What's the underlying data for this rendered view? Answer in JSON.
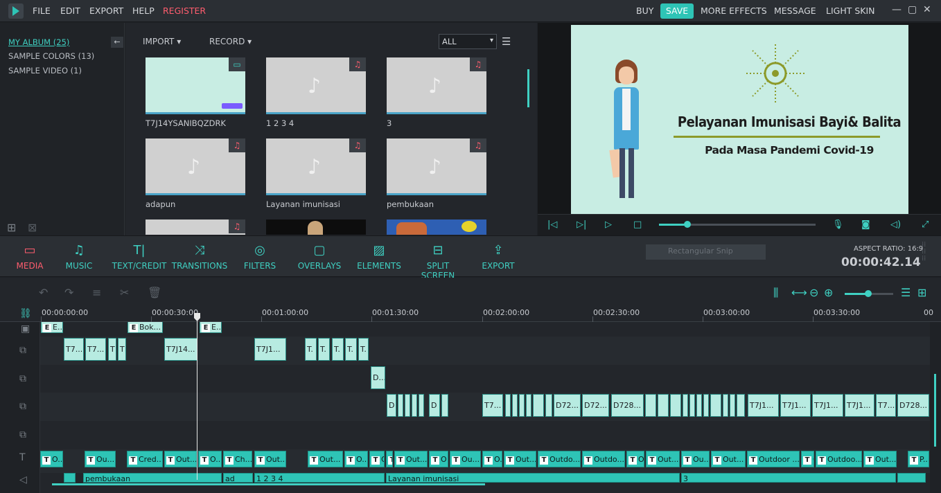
{
  "menu": {
    "file": "FILE",
    "edit": "EDIT",
    "export": "EXPORT",
    "help": "HELP",
    "register": "REGISTER",
    "buy": "BUY",
    "save": "SAVE",
    "more_effects": "MORE EFFECTS",
    "message": "MESSAGE",
    "light_skin": "LIGHT SKIN"
  },
  "album": {
    "items": [
      {
        "label": "MY ALBUM (25)"
      },
      {
        "label": "SAMPLE COLORS (13)"
      },
      {
        "label": "SAMPLE VIDEO (1)"
      }
    ]
  },
  "media": {
    "import": "IMPORT",
    "record": "RECORD",
    "filter_value": "ALL",
    "thumbs": [
      {
        "label": "T7J14YSANIBQZDRK",
        "kind": "video"
      },
      {
        "label": "1 2 3 4",
        "kind": "audio"
      },
      {
        "label": "3",
        "kind": "audio"
      },
      {
        "label": "adapun",
        "kind": "audio"
      },
      {
        "label": "Layanan imunisasi",
        "kind": "audio"
      },
      {
        "label": "pembukaan",
        "kind": "audio"
      }
    ]
  },
  "preview": {
    "title": "Pelayanan Imunisasi Bayi& Balita",
    "subtitle": "Pada Masa Pandemi Covid-19",
    "progress": 0.18
  },
  "tabs": [
    {
      "label": "MEDIA",
      "icon": "folder-icon",
      "active": true
    },
    {
      "label": "MUSIC",
      "icon": "music-icon"
    },
    {
      "label": "TEXT/CREDIT",
      "icon": "text-icon"
    },
    {
      "label": "TRANSITIONS",
      "icon": "transitions-icon"
    },
    {
      "label": "FILTERS",
      "icon": "filters-icon"
    },
    {
      "label": "OVERLAYS",
      "icon": "overlays-icon"
    },
    {
      "label": "ELEMENTS",
      "icon": "elements-icon"
    },
    {
      "label": "SPLIT SCREEN",
      "icon": "split-screen-icon"
    },
    {
      "label": "EXPORT",
      "icon": "export-icon"
    }
  ],
  "status": {
    "snip": "Rectangular Snip",
    "aspect_ratio": "ASPECT RATIO: 16:9",
    "timecode": "00:00:42.14"
  },
  "ruler": {
    "labels": [
      "00:00:00:00",
      "00:00:30:00",
      "00:01:00:00",
      "00:01:30:00",
      "00:02:00:00",
      "00:02:30:00",
      "00:03:00:00",
      "00:03:30:00",
      "00"
    ]
  },
  "clips": {
    "row1": [
      "E...",
      "Bok...",
      "E..."
    ],
    "row2": [
      "T7...",
      "T7...",
      "T",
      "T",
      "T7J14...",
      "T7J1...",
      "T.",
      "T.",
      "T.",
      "T.",
      "T."
    ],
    "row3": [
      "D..."
    ],
    "row4": [
      "D",
      "D",
      "D72...",
      "D72...",
      "D728...",
      "T7...",
      "T7J1...",
      "T7J1...",
      "T7J1...",
      "T7J1...",
      "T7...",
      "D728..."
    ],
    "text_row": [
      "O...",
      "Ou...",
      "Cred...",
      "Out...",
      "O...",
      "Ch...",
      "Out...",
      "Out...",
      "O...",
      "O",
      "Out...",
      "O",
      "Ou...",
      "O...",
      "Out...",
      "Outdo...",
      "Outdo...",
      "O",
      "Out...",
      "Ou...",
      "Out...",
      "Outdoor ...",
      "O",
      "Outdoo...",
      "Out...",
      "P..."
    ],
    "audio_row": [
      "pembukaan",
      "ad",
      "1 2 3 4",
      "Layanan imunisasi",
      "3"
    ]
  }
}
